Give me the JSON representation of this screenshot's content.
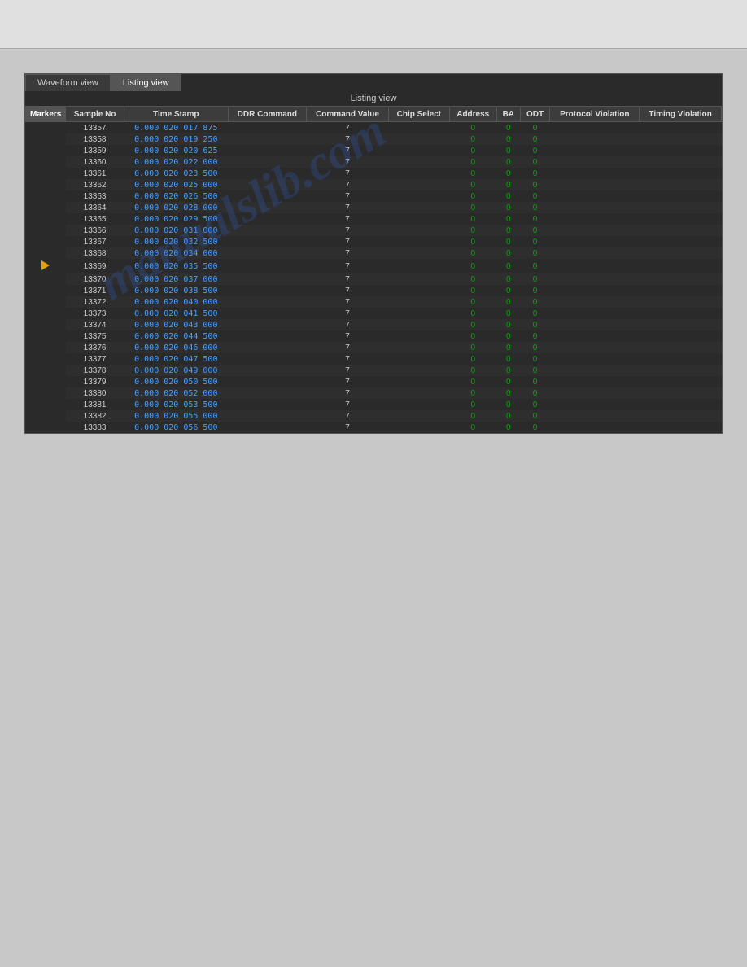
{
  "topBar": {},
  "tabs": [
    {
      "label": "Waveform view",
      "active": false
    },
    {
      "label": "Listing view",
      "active": true
    }
  ],
  "listingViewLabel": "Listing view",
  "columns": [
    {
      "key": "markers",
      "label": "Markers"
    },
    {
      "key": "sampleNo",
      "label": "Sample No"
    },
    {
      "key": "timeStamp",
      "label": "Time Stamp"
    },
    {
      "key": "ddrCommand",
      "label": "DDR Command"
    },
    {
      "key": "commandValue",
      "label": "Command Value"
    },
    {
      "key": "chipSelect",
      "label": "Chip Select"
    },
    {
      "key": "address",
      "label": "Address"
    },
    {
      "key": "ba",
      "label": "BA"
    },
    {
      "key": "odt",
      "label": "ODT"
    },
    {
      "key": "protocolViolation",
      "label": "Protocol Violation"
    },
    {
      "key": "timingViolation",
      "label": "Timing Violation"
    }
  ],
  "rows": [
    {
      "sampleNo": "13357",
      "timeStamp": "0.000 020 017 875",
      "commandValue": "7",
      "chipSelect": "",
      "address": "0",
      "ba": "0",
      "odt": "0",
      "marker": false
    },
    {
      "sampleNo": "13358",
      "timeStamp": "0.000 020 019 250",
      "commandValue": "7",
      "chipSelect": "",
      "address": "0",
      "ba": "0",
      "odt": "0",
      "marker": false
    },
    {
      "sampleNo": "13359",
      "timeStamp": "0.000 020 020 625",
      "commandValue": "7",
      "chipSelect": "",
      "address": "0",
      "ba": "0",
      "odt": "0",
      "marker": false
    },
    {
      "sampleNo": "13360",
      "timeStamp": "0.000 020 022 000",
      "commandValue": "7",
      "chipSelect": "",
      "address": "0",
      "ba": "0",
      "odt": "0",
      "marker": false
    },
    {
      "sampleNo": "13361",
      "timeStamp": "0.000 020 023 500",
      "commandValue": "7",
      "chipSelect": "",
      "address": "0",
      "ba": "0",
      "odt": "0",
      "marker": false
    },
    {
      "sampleNo": "13362",
      "timeStamp": "0.000 020 025 000",
      "commandValue": "7",
      "chipSelect": "",
      "address": "0",
      "ba": "0",
      "odt": "0",
      "marker": false
    },
    {
      "sampleNo": "13363",
      "timeStamp": "0.000 020 026 500",
      "commandValue": "7",
      "chipSelect": "",
      "address": "0",
      "ba": "0",
      "odt": "0",
      "marker": false
    },
    {
      "sampleNo": "13364",
      "timeStamp": "0.000 020 028 000",
      "commandValue": "7",
      "chipSelect": "",
      "address": "0",
      "ba": "0",
      "odt": "0",
      "marker": false
    },
    {
      "sampleNo": "13365",
      "timeStamp": "0.000 020 029 500",
      "commandValue": "7",
      "chipSelect": "",
      "address": "0",
      "ba": "0",
      "odt": "0",
      "marker": false
    },
    {
      "sampleNo": "13366",
      "timeStamp": "0.000 020 031 000",
      "commandValue": "7",
      "chipSelect": "",
      "address": "0",
      "ba": "0",
      "odt": "0",
      "marker": false
    },
    {
      "sampleNo": "13367",
      "timeStamp": "0.000 020 032 500",
      "commandValue": "7",
      "chipSelect": "",
      "address": "0",
      "ba": "0",
      "odt": "0",
      "marker": false
    },
    {
      "sampleNo": "13368",
      "timeStamp": "0.000 020 034 000",
      "commandValue": "7",
      "chipSelect": "",
      "address": "0",
      "ba": "0",
      "odt": "0",
      "marker": false
    },
    {
      "sampleNo": "13369",
      "timeStamp": "0.000 020 035 500",
      "commandValue": "7",
      "chipSelect": "",
      "address": "0",
      "ba": "0",
      "odt": "0",
      "marker": true
    },
    {
      "sampleNo": "13370",
      "timeStamp": "0.000 020 037 000",
      "commandValue": "7",
      "chipSelect": "",
      "address": "0",
      "ba": "0",
      "odt": "0",
      "marker": false
    },
    {
      "sampleNo": "13371",
      "timeStamp": "0.000 020 038 500",
      "commandValue": "7",
      "chipSelect": "",
      "address": "0",
      "ba": "0",
      "odt": "0",
      "marker": false
    },
    {
      "sampleNo": "13372",
      "timeStamp": "0.000 020 040 000",
      "commandValue": "7",
      "chipSelect": "",
      "address": "0",
      "ba": "0",
      "odt": "0",
      "marker": false
    },
    {
      "sampleNo": "13373",
      "timeStamp": "0.000 020 041 500",
      "commandValue": "7",
      "chipSelect": "",
      "address": "0",
      "ba": "0",
      "odt": "0",
      "marker": false
    },
    {
      "sampleNo": "13374",
      "timeStamp": "0.000 020 043 000",
      "commandValue": "7",
      "chipSelect": "",
      "address": "0",
      "ba": "0",
      "odt": "0",
      "marker": false
    },
    {
      "sampleNo": "13375",
      "timeStamp": "0.000 020 044 500",
      "commandValue": "7",
      "chipSelect": "",
      "address": "0",
      "ba": "0",
      "odt": "0",
      "marker": false
    },
    {
      "sampleNo": "13376",
      "timeStamp": "0.000 020 046 000",
      "commandValue": "7",
      "chipSelect": "",
      "address": "0",
      "ba": "0",
      "odt": "0",
      "marker": false
    },
    {
      "sampleNo": "13377",
      "timeStamp": "0.000 020 047 500",
      "commandValue": "7",
      "chipSelect": "",
      "address": "0",
      "ba": "0",
      "odt": "0",
      "marker": false
    },
    {
      "sampleNo": "13378",
      "timeStamp": "0.000 020 049 000",
      "commandValue": "7",
      "chipSelect": "",
      "address": "0",
      "ba": "0",
      "odt": "0",
      "marker": false
    },
    {
      "sampleNo": "13379",
      "timeStamp": "0.000 020 050 500",
      "commandValue": "7",
      "chipSelect": "",
      "address": "0",
      "ba": "0",
      "odt": "0",
      "marker": false
    },
    {
      "sampleNo": "13380",
      "timeStamp": "0.000 020 052 000",
      "commandValue": "7",
      "chipSelect": "",
      "address": "0",
      "ba": "0",
      "odt": "0",
      "marker": false
    },
    {
      "sampleNo": "13381",
      "timeStamp": "0.000 020 053 500",
      "commandValue": "7",
      "chipSelect": "",
      "address": "0",
      "ba": "0",
      "odt": "0",
      "marker": false
    },
    {
      "sampleNo": "13382",
      "timeStamp": "0.000 020 055 000",
      "commandValue": "7",
      "chipSelect": "",
      "address": "0",
      "ba": "0",
      "odt": "0",
      "marker": false
    },
    {
      "sampleNo": "13383",
      "timeStamp": "0.000 020 056 500",
      "commandValue": "7",
      "chipSelect": "",
      "address": "0",
      "ba": "0",
      "odt": "0",
      "marker": false
    }
  ],
  "watermark": "manualslib.com"
}
